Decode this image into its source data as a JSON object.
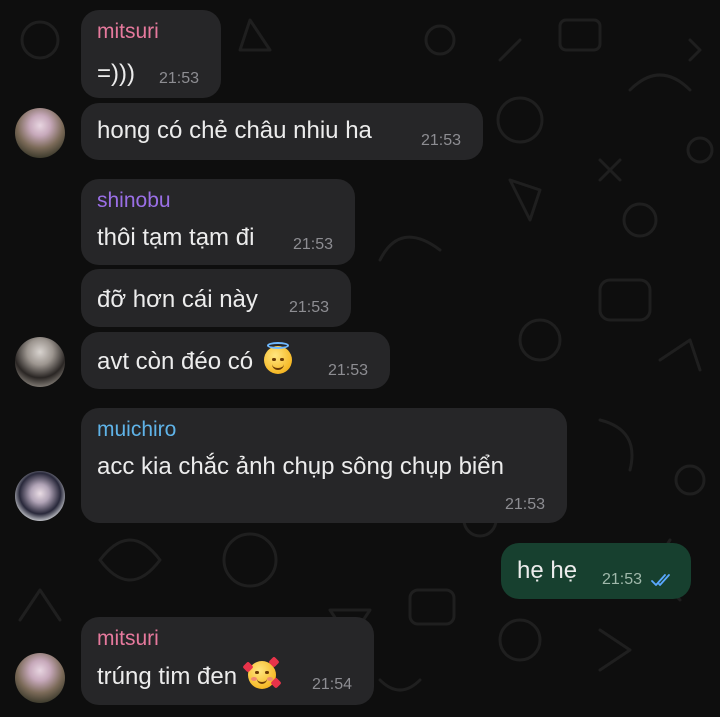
{
  "messages": [
    {
      "sender": "mitsuri",
      "sender_color": "#e6799d",
      "text": "=)))",
      "time": "21:53"
    },
    {
      "text": "hong có chẻ châu nhiu ha",
      "time": "21:53"
    },
    {
      "sender": "shinobu",
      "sender_color": "#9a6fe6",
      "text": "thôi tạm tạm đi",
      "time": "21:53"
    },
    {
      "text": "đỡ hơn cái này",
      "time": "21:53"
    },
    {
      "text": "avt còn đéo có",
      "emoji": "smiling-face-with-halo",
      "time": "21:53"
    },
    {
      "sender": "muichiro",
      "sender_color": "#5fb3e8",
      "text": "acc kia chắc ảnh chụp sông chụp biển",
      "time": "21:53"
    },
    {
      "outgoing": true,
      "text": "hẹ hẹ",
      "time": "21:53",
      "status": "read"
    },
    {
      "sender": "mitsuri",
      "sender_color": "#e6799d",
      "text": "trúng tim đen",
      "emoji": "smiling-face-with-hearts",
      "time": "21:54"
    }
  ],
  "colors": {
    "background": "#0e0e0e",
    "incoming_bubble": "#262628",
    "outgoing_bubble": "#17402f",
    "read_ticks": "#5aa8ff"
  }
}
